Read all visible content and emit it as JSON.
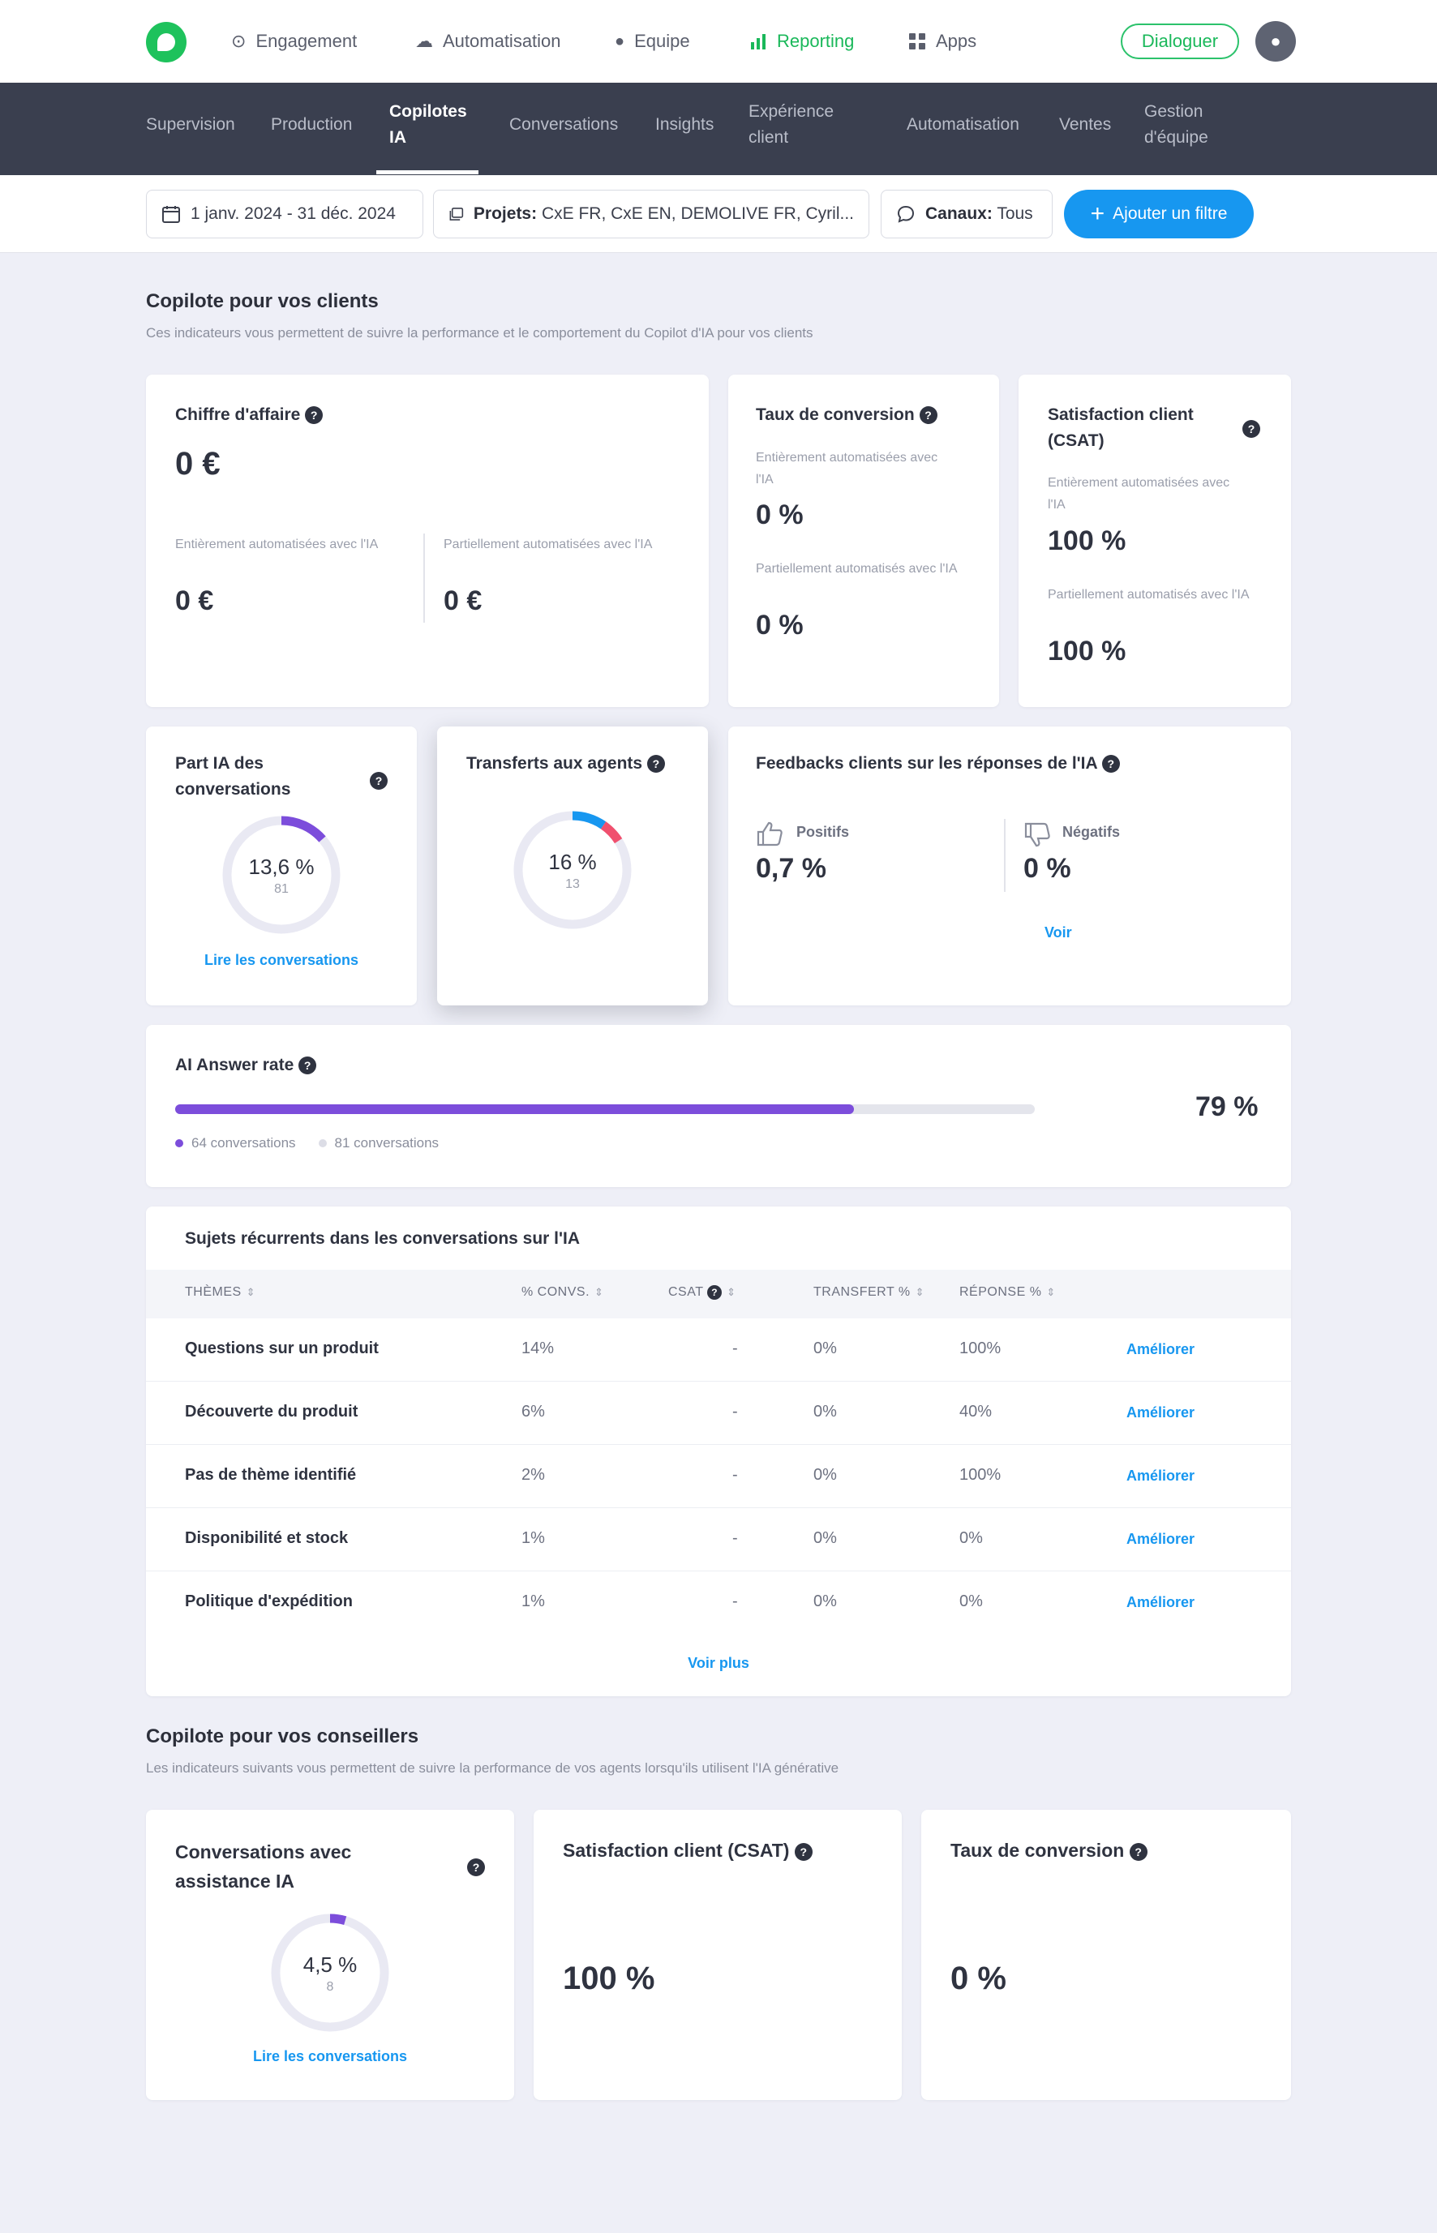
{
  "topnav": {
    "items": [
      {
        "label": "Engagement",
        "icon": "target-icon",
        "glyph": "⊙"
      },
      {
        "label": "Automatisation",
        "icon": "cloud-icon",
        "glyph": "☁"
      },
      {
        "label": "Equipe",
        "icon": "user-icon",
        "glyph": "👤"
      },
      {
        "label": "Reporting",
        "icon": "bar-chart-icon",
        "glyph": "▮"
      },
      {
        "label": "Apps",
        "icon": "grid-icon",
        "glyph": "▦"
      }
    ],
    "active": "Reporting",
    "dialoguer_label": "Dialoguer"
  },
  "subnav": {
    "items": [
      {
        "l1": "Supervision",
        "l2": ""
      },
      {
        "l1": "Production",
        "l2": ""
      },
      {
        "l1": "Copilotes",
        "l2": "IA"
      },
      {
        "l1": "Conversations",
        "l2": ""
      },
      {
        "l1": "Insights",
        "l2": ""
      },
      {
        "l1": "Expérience",
        "l2": "client"
      },
      {
        "l1": "Automatisation",
        "l2": ""
      },
      {
        "l1": "Ventes",
        "l2": ""
      },
      {
        "l1": "Gestion",
        "l2": "d'équipe"
      }
    ],
    "active": "Copilotes IA"
  },
  "filters": {
    "date": "1 janv. 2024 - 31 déc. 2024",
    "projects_label": "Projets:",
    "projects_value": "CxE FR, CxE EN, DEMOLIVE FR, Cyril...",
    "channels_label": "Canaux:",
    "channels_value": "Tous",
    "add_filter": "Ajouter un filtre"
  },
  "clients": {
    "title": "Copilote pour vos clients",
    "subtitle": "Ces indicateurs vous permettent de suivre la performance et le comportement du Copilot d'IA pour vos clients",
    "revenue": {
      "title": "Chiffre d'affaire",
      "value": "0 €",
      "full_label": "Entièrement automatisées avec l'IA",
      "full_value": "0 €",
      "partial_label": "Partiellement automatisées avec l'IA",
      "partial_value": "0 €"
    },
    "conversion": {
      "title": "Taux de conversion",
      "full_label": "Entièrement automatisées avec l'IA",
      "full_value": "0 %",
      "partial_label": "Partiellement automatisés avec l'IA",
      "partial_value": "0 %"
    },
    "csat": {
      "title_l1": "Satisfaction client",
      "title_l2": "(CSAT)",
      "full_label": "Entièrement automatisées avec l'IA",
      "full_value": "100 %",
      "partial_label": "Partiellement automatisés avec l'IA",
      "partial_value": "100 %"
    },
    "ai_share": {
      "title_l1": "Part IA des",
      "title_l2": "conversations",
      "value": "13,6 %",
      "count": "81",
      "fraction": 0.136,
      "link": "Lire les conversations"
    },
    "transfers": {
      "title": "Transferts aux agents",
      "value": "16 %",
      "count": "13",
      "fraction": 0.16
    },
    "feedback": {
      "title": "Feedbacks clients sur les réponses de l'IA",
      "positive_label": "Positifs",
      "positive_value": "0,7 %",
      "negative_label": "Négatifs",
      "negative_value": "0 %",
      "link": "Voir"
    },
    "answer_rate": {
      "title": "AI Answer rate",
      "value": "79 %",
      "fraction": 0.79,
      "legend_answered": "64 conversations",
      "legend_total": "81 conversations"
    }
  },
  "topics": {
    "title": "Sujets récurrents dans les conversations sur l'IA",
    "columns": [
      "THÈMES",
      "% CONVS.",
      "CSAT",
      "TRANSFERT %",
      "RÉPONSE %"
    ],
    "rows": [
      {
        "theme": "Questions sur un produit",
        "convs": "14%",
        "csat": "-",
        "transfer": "0%",
        "response": "100%",
        "action": "Améliorer"
      },
      {
        "theme": "Découverte du produit",
        "convs": "6%",
        "csat": "-",
        "transfer": "0%",
        "response": "40%",
        "action": "Améliorer"
      },
      {
        "theme": "Pas de thème identifié",
        "convs": "2%",
        "csat": "-",
        "transfer": "0%",
        "response": "100%",
        "action": "Améliorer"
      },
      {
        "theme": "Disponibilité et stock",
        "convs": "1%",
        "csat": "-",
        "transfer": "0%",
        "response": "0%",
        "action": "Améliorer"
      },
      {
        "theme": "Politique d'expédition",
        "convs": "1%",
        "csat": "-",
        "transfer": "0%",
        "response": "0%",
        "action": "Améliorer"
      }
    ],
    "more": "Voir plus"
  },
  "advisors": {
    "title": "Copilote pour vos conseillers",
    "subtitle": "Les indicateurs suivants vous permettent de suivre la performance de vos agents lorsqu'ils utilisent l'IA générative",
    "assisted": {
      "title_l1": "Conversations avec",
      "title_l2": "assistance IA",
      "value": "4,5 %",
      "count": "8",
      "fraction": 0.045,
      "link": "Lire les conversations"
    },
    "csat": {
      "title": "Satisfaction client (CSAT)",
      "value": "100 %"
    },
    "conversion": {
      "title": "Taux de conversion",
      "value": "0 %"
    }
  },
  "colors": {
    "brand_green": "#1ec25c",
    "accent_blue": "#1797f0",
    "purple": "#7c4ddb",
    "red": "#f0506e",
    "track": "#e9e9f3"
  }
}
